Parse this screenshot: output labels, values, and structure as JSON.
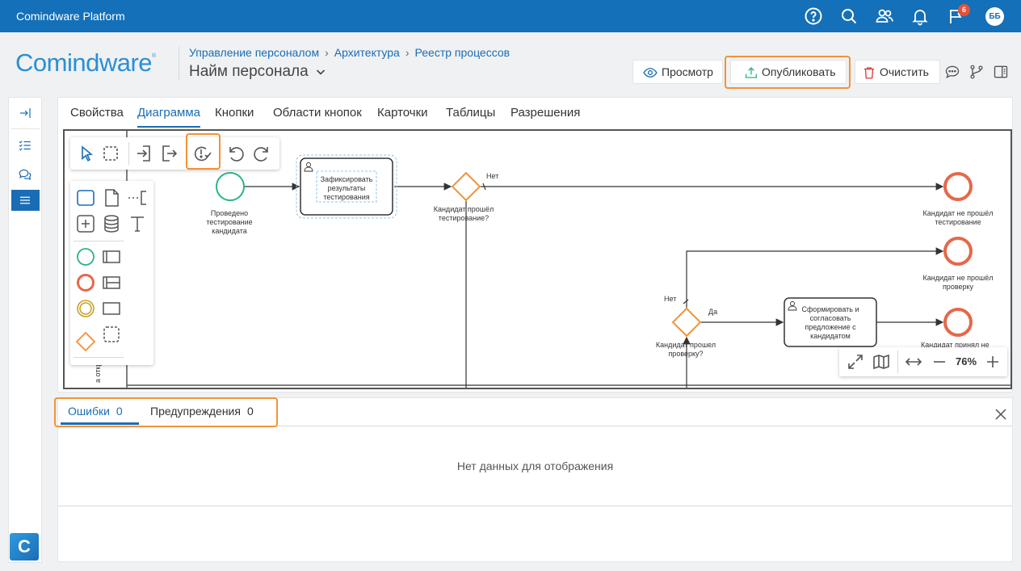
{
  "topbar": {
    "app_title": "Comindware Platform",
    "icons": [
      "help-icon",
      "search-icon",
      "users-icon",
      "bell-icon",
      "flag-icon"
    ],
    "notification_count": "6",
    "user_initials": "ББ",
    "bg_color": "#1470b8"
  },
  "header": {
    "logo_text": "Comindware",
    "logo_mark": "®",
    "breadcrumbs": [
      "Управление персоналом",
      "Архитектура",
      "Реестр процессов"
    ],
    "page_title": "Найм персонала",
    "buttons": {
      "preview": "Просмотр",
      "publish": "Опубликовать",
      "clear": "Очистить"
    }
  },
  "tabs": [
    "Свойства",
    "Диаграмма",
    "Кнопки",
    "Области кнопок",
    "Карточки",
    "Таблицы",
    "Разрешения"
  ],
  "active_tab": "Диаграмма",
  "diagram": {
    "start_event": "Проведено тестирование кандидата",
    "task1": "Зафиксировать результаты тестирования",
    "gateway1": "Кандидат прошёл тестирование?",
    "end1": "Кандидат не прошёл тестирование",
    "end2": "Кандидат не прошёл проверку",
    "gateway2": "Кандидат прошел проверку?",
    "task2": "Сформировать и согласовать предложение с кандидатом",
    "end3_partial": "Кандидат принял не",
    "label_no": "Нет",
    "label_yes": "Да",
    "lane_label": "а откры",
    "zoom": "76%"
  },
  "bottom_panel": {
    "errors_label": "Ошибки",
    "errors_count": "0",
    "warnings_label": "Предупреждения",
    "warnings_count": "0",
    "empty_text": "Нет данных для отображения"
  },
  "colors": {
    "accent": "#1a6db5",
    "highlight": "#f0933a",
    "start_event": "#2bb38b",
    "end_event": "#e5684a",
    "gateway": "#f0933a"
  }
}
